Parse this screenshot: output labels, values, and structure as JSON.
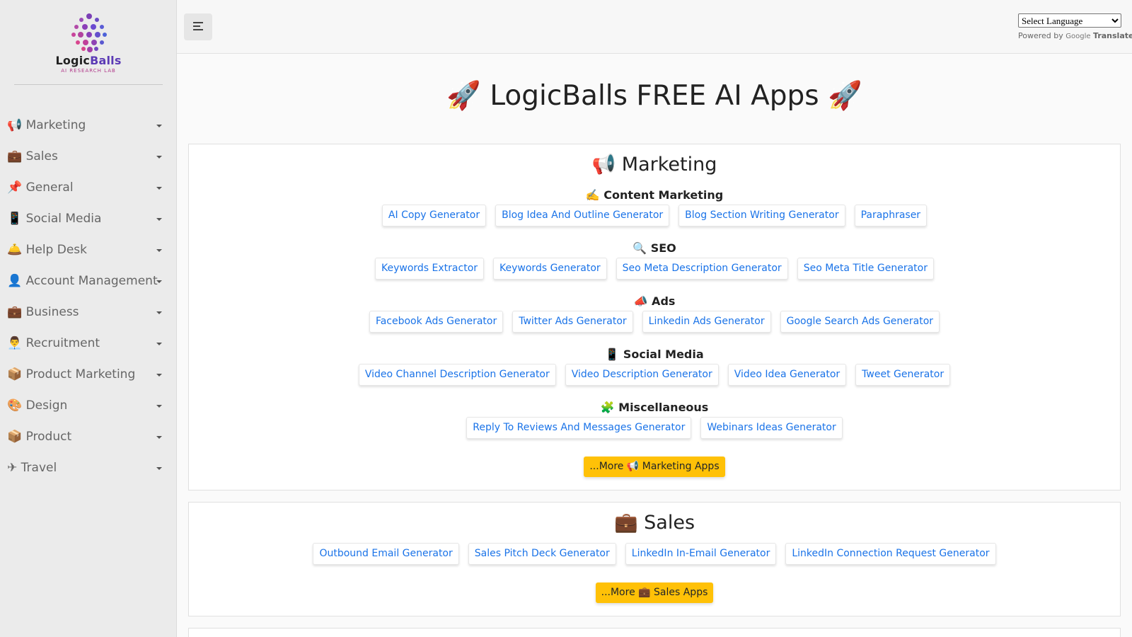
{
  "sidebar": {
    "logo": {
      "name_part1": "Logic",
      "name_part2": "Balls",
      "tagline": "AI RESEARCH LAB"
    },
    "items": [
      {
        "icon": "📢",
        "label": " Marketing"
      },
      {
        "icon": "💼",
        "label": " Sales"
      },
      {
        "icon": "📌",
        "label": " General"
      },
      {
        "icon": "📱",
        "label": " Social Media"
      },
      {
        "icon": "🛎️",
        "label": " Help Desk"
      },
      {
        "icon": "👤",
        "label": " Account Management"
      },
      {
        "icon": "💼",
        "label": " Business"
      },
      {
        "icon": "👨‍💼",
        "label": " Recruitment"
      },
      {
        "icon": "📦",
        "label": " Product Marketing"
      },
      {
        "icon": "🎨",
        "label": " Design"
      },
      {
        "icon": "📦",
        "label": " Product"
      },
      {
        "icon": "✈",
        "label": " Travel"
      }
    ]
  },
  "topbar": {
    "language_select": "Select Language",
    "powered_by": "Powered by",
    "google": "Google",
    "translate": "Translate"
  },
  "main": {
    "title": "🚀 LogicBalls FREE AI Apps 🚀"
  },
  "sections": [
    {
      "title": "📢 Marketing",
      "groups": [
        {
          "title": "✍️ Content Marketing",
          "apps": [
            "AI Copy Generator",
            "Blog Idea And Outline Generator",
            "Blog Section Writing Generator",
            "Paraphraser"
          ]
        },
        {
          "title": "🔍 SEO",
          "apps": [
            "Keywords Extractor",
            "Keywords Generator",
            "Seo Meta Description Generator",
            "Seo Meta Title Generator"
          ]
        },
        {
          "title": "📣 Ads",
          "apps": [
            "Facebook Ads Generator",
            "Twitter Ads Generator",
            "Linkedin Ads Generator",
            "Google Search Ads Generator"
          ]
        },
        {
          "title": "📱 Social Media",
          "apps": [
            "Video Channel Description Generator",
            "Video Description Generator",
            "Video Idea Generator",
            "Tweet Generator"
          ]
        },
        {
          "title": "🧩 Miscellaneous",
          "apps": [
            "Reply To Reviews And Messages Generator",
            "Webinars Ideas Generator"
          ]
        }
      ],
      "more_button": "...More 📢 Marketing Apps"
    },
    {
      "title": "💼 Sales",
      "groups": [
        {
          "title": "",
          "apps": [
            "Outbound Email Generator",
            "Sales Pitch Deck Generator",
            "LinkedIn In-Email Generator",
            "LinkedIn Connection Request Generator"
          ]
        }
      ],
      "more_button": "...More 💼 Sales Apps"
    }
  ],
  "colors": {
    "accent": "#ffc107",
    "link": "#1a73e8",
    "sidebar_bg": "#ebebeb"
  }
}
